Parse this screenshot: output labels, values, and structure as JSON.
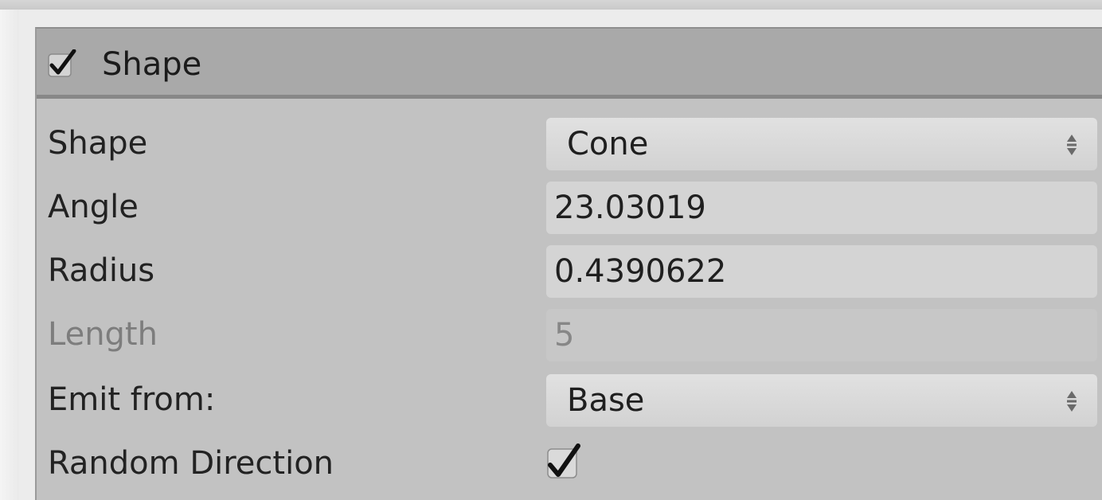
{
  "module": {
    "title": "Shape",
    "enabled": true
  },
  "fields": {
    "shape": {
      "label": "Shape",
      "value": "Cone"
    },
    "angle": {
      "label": "Angle",
      "value": "23.03019"
    },
    "radius": {
      "label": "Radius",
      "value": "0.4390622"
    },
    "length": {
      "label": "Length",
      "value": "5"
    },
    "emit_from": {
      "label": "Emit from:",
      "value": "Base"
    },
    "random_direction": {
      "label": "Random Direction",
      "checked": true
    }
  },
  "icons": {
    "module_toggle": "checkmark-icon",
    "dropdown_arrows": "up-down-arrows-icon",
    "random_direction_check": "checkmark-icon"
  },
  "colors": {
    "panel_bg": "#c2c2c2",
    "header_bg": "#a9a9a9",
    "field_bg": "#d4d4d4",
    "disabled_text": "#7d7d7d"
  }
}
